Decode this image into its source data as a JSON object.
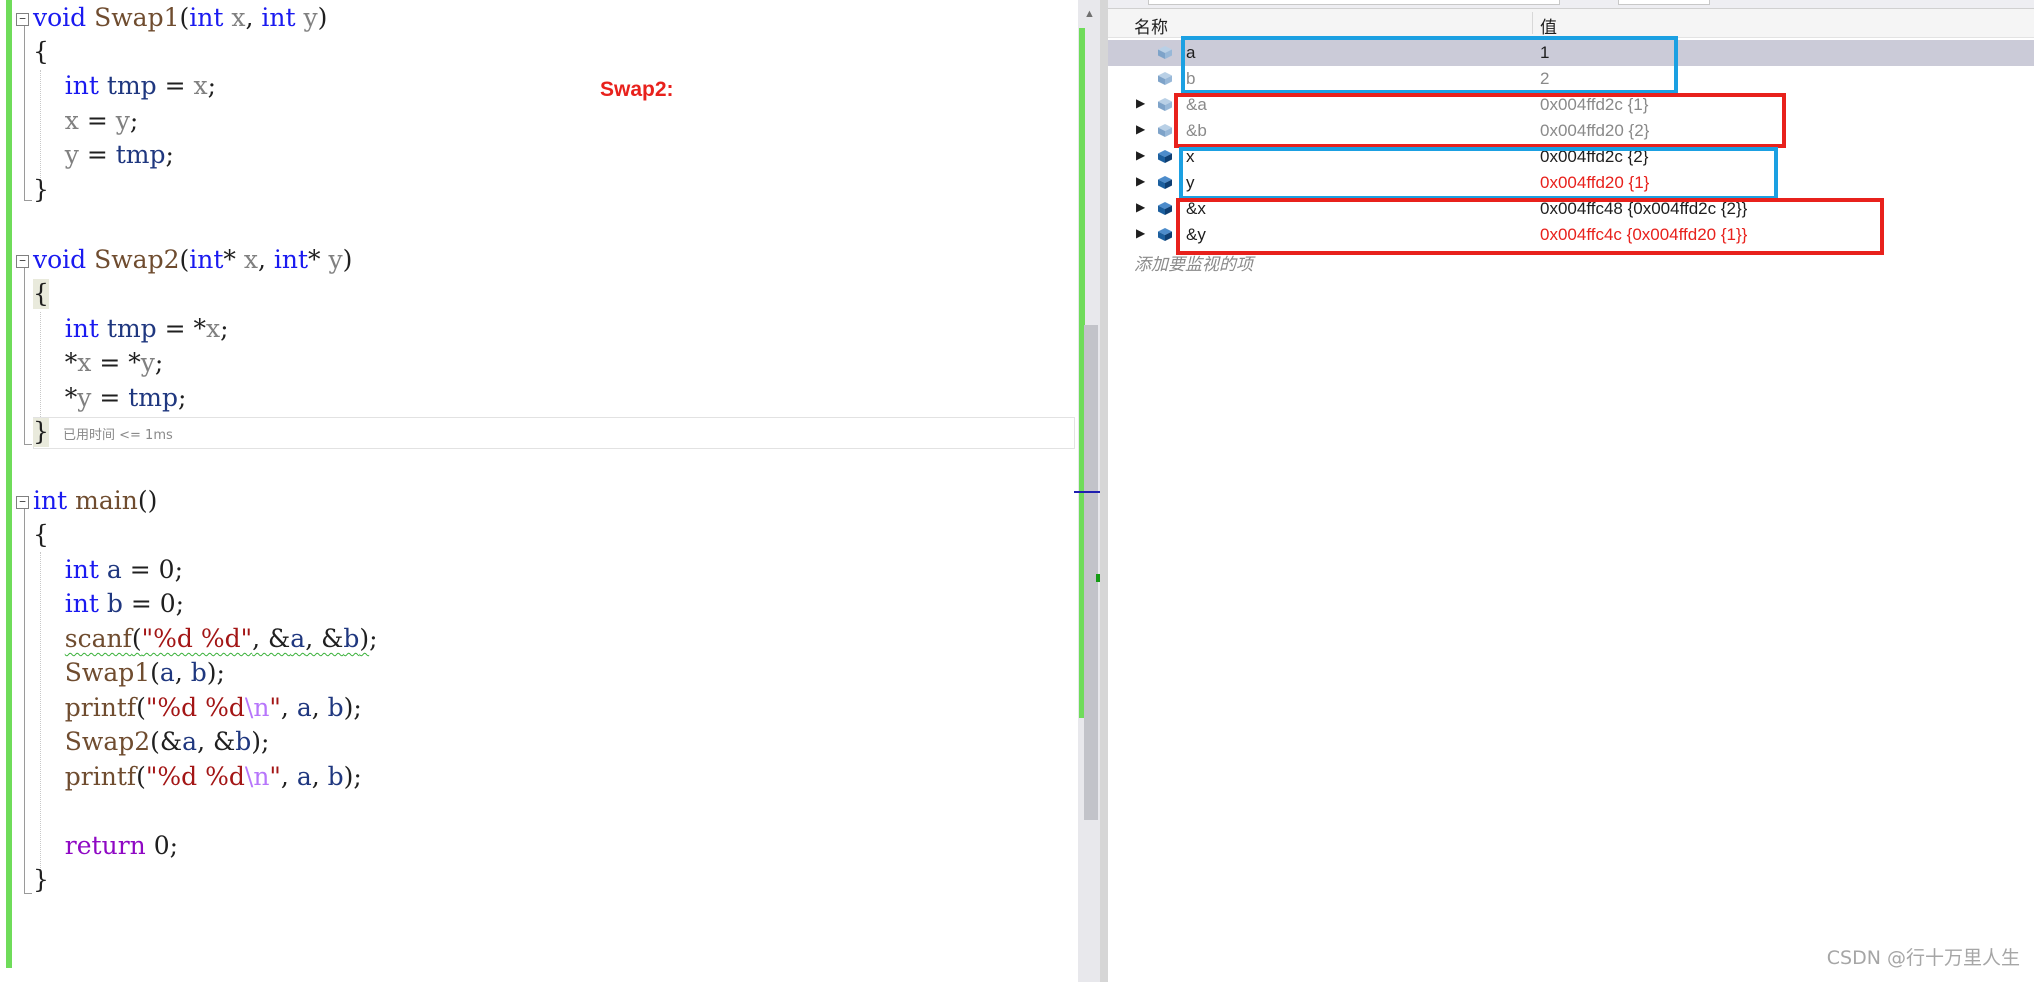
{
  "editor": {
    "code": {
      "l1_kw": "void",
      "l1_fn": "Swap1",
      "l1_int1": "int",
      "l1_x": "x",
      "l1_int2": "int",
      "l1_y": "y",
      "l3_int": "int",
      "l3_tmp": "tmp",
      "l3_x": "x",
      "l4_x": "x",
      "l4_y": "y",
      "l5_y": "y",
      "l5_tmp": "tmp",
      "l8_kw": "void",
      "l8_fn": "Swap2",
      "l8_int1": "int",
      "l8_x": "x",
      "l8_int2": "int",
      "l8_y": "y",
      "l10_int": "int",
      "l10_tmp": "tmp",
      "l10_x": "x",
      "l11_x": "x",
      "l11_y": "y",
      "l12_y": "y",
      "l12_tmp": "tmp",
      "l15_int": "int",
      "l15_main": "main",
      "l17_int": "int",
      "l17_a": "a",
      "l17_val": "0",
      "l18_int": "int",
      "l18_b": "b",
      "l18_val": "0",
      "l19_fn": "scanf",
      "l19_str": "\"%d %d\"",
      "l19_a": "a",
      "l19_b": "b",
      "l20_fn": "Swap1",
      "l20_a": "a",
      "l20_b": "b",
      "l21_fn": "printf",
      "l21_str1": "\"%d %d",
      "l21_esc": "\\n",
      "l21_str2": "\"",
      "l21_a": "a",
      "l21_b": "b",
      "l22_fn": "Swap2",
      "l22_a": "a",
      "l22_b": "b",
      "l23_fn": "printf",
      "l23_str1": "\"%d %d",
      "l23_esc": "\\n",
      "l23_str2": "\"",
      "l23_a": "a",
      "l23_b": "b",
      "l25_ret": "return",
      "l25_val": "0"
    },
    "elapsed_text": "已用时间 <= 1ms",
    "annotation": "Swap2:"
  },
  "watch": {
    "columns": {
      "name": "名称",
      "value": "值"
    },
    "rows": [
      {
        "name": "a",
        "value": "1",
        "selected": true,
        "expandable": false,
        "faded": false,
        "changed": false
      },
      {
        "name": "b",
        "value": "2",
        "selected": false,
        "expandable": false,
        "faded": true,
        "changed": false
      },
      {
        "name": "&a",
        "value": "0x004ffd2c {1}",
        "selected": false,
        "expandable": true,
        "faded": true,
        "changed": false
      },
      {
        "name": "&b",
        "value": "0x004ffd20 {2}",
        "selected": false,
        "expandable": true,
        "faded": true,
        "changed": false
      },
      {
        "name": "x",
        "value": "0x004ffd2c {2}",
        "selected": false,
        "expandable": true,
        "faded": false,
        "changed": false
      },
      {
        "name": "y",
        "value": "0x004ffd20 {1}",
        "selected": false,
        "expandable": true,
        "faded": false,
        "changed": true
      },
      {
        "name": "&x",
        "value": "0x004ffc48 {0x004ffd2c {2}}",
        "selected": false,
        "expandable": true,
        "faded": false,
        "changed": false
      },
      {
        "name": "&y",
        "value": "0x004ffc4c {0x004ffd20 {1}}",
        "selected": false,
        "expandable": true,
        "faded": false,
        "changed": true
      }
    ],
    "add_watch": "添加要监视的项"
  },
  "colors": {
    "highlight_blue": "#1ba0e2",
    "highlight_red": "#e8211c",
    "changed_value": "#e8211c",
    "change_bar": "#6fdc5a"
  },
  "watermark": "CSDN @行十万里人生"
}
